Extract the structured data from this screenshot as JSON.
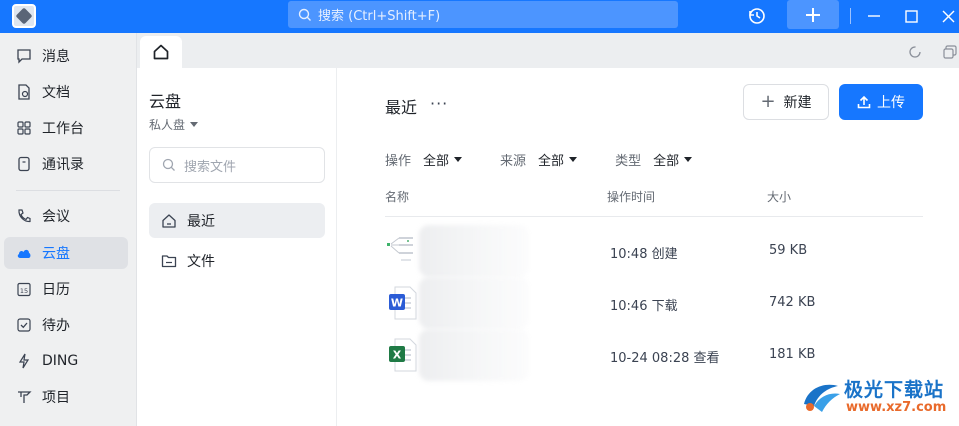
{
  "topbar": {
    "search_placeholder": "搜索 (Ctrl+Shift+F)"
  },
  "sidebar": {
    "items": [
      {
        "label": "消息",
        "icon": "message-icon"
      },
      {
        "label": "文档",
        "icon": "document-icon"
      },
      {
        "label": "工作台",
        "icon": "grid-icon"
      },
      {
        "label": "通讯录",
        "icon": "contacts-icon"
      },
      {
        "label": "会议",
        "icon": "phone-icon"
      },
      {
        "label": "云盘",
        "icon": "cloud-icon"
      },
      {
        "label": "日历",
        "icon": "calendar-icon"
      },
      {
        "label": "待办",
        "icon": "todo-check-icon"
      },
      {
        "label": "DING",
        "icon": "lightning-icon"
      },
      {
        "label": "项目",
        "icon": "project-icon"
      }
    ],
    "active": "云盘",
    "calendar_day": "15"
  },
  "panel": {
    "title": "云盘",
    "subtitle": "私人盘",
    "search_placeholder": "搜索文件",
    "items": [
      {
        "label": "最近",
        "icon": "home-icon"
      },
      {
        "label": "文件",
        "icon": "folder-icon"
      }
    ]
  },
  "main": {
    "title": "最近",
    "more": "···",
    "new_label": "新建",
    "upload_label": "上传",
    "filters": [
      {
        "label": "操作",
        "value": "全部"
      },
      {
        "label": "来源",
        "value": "全部"
      },
      {
        "label": "类型",
        "value": "全部"
      }
    ],
    "columns": {
      "name": "名称",
      "time": "操作时间",
      "size": "大小"
    },
    "rows": [
      {
        "time": "10:48 创建",
        "size": "59 KB",
        "type": "mindmap"
      },
      {
        "time": "10:46 下载",
        "size": "742 KB",
        "type": "word"
      },
      {
        "time": "10-24 08:28 查看",
        "size": "181 KB",
        "type": "excel"
      }
    ]
  },
  "watermark": {
    "name": "极光下载站",
    "url": "www.xz7.com"
  },
  "colors": {
    "accent": "#1677ff",
    "word": "#2b5cd6",
    "excel": "#1f7a45",
    "watermark_blue": "#1a73c8",
    "watermark_orange": "#e96a2b"
  }
}
